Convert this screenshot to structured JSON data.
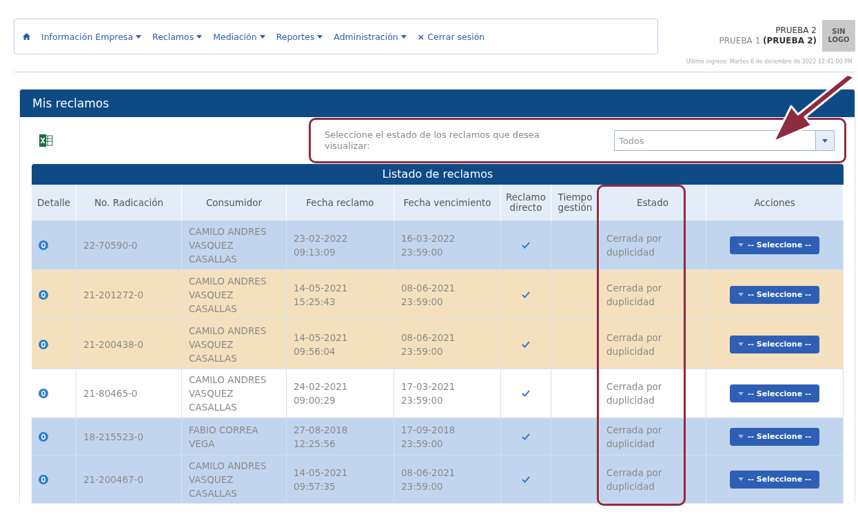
{
  "nav": {
    "items": [
      {
        "label": "Información Empresa",
        "dropdown": true
      },
      {
        "label": "Reclamos",
        "dropdown": true
      },
      {
        "label": "Mediación",
        "dropdown": true
      },
      {
        "label": "Reportes",
        "dropdown": true
      },
      {
        "label": "Administración",
        "dropdown": true
      }
    ],
    "logout_icon": "×",
    "logout": "Cerrar sesión"
  },
  "user": {
    "name": "PRUEBA 2",
    "line_prefix": "PRUEBA 1 ",
    "line_bold": "(PRUEBA 2)",
    "logo": "SIN\nLOGO",
    "last_login": "Ultimo ingreso: Martes 6 de diciembre de 2022 12:41:00 PM"
  },
  "panel": {
    "title": "Mis reclamos",
    "filter": {
      "label": "Seleccione el estado de los reclamos que desea visualizar:",
      "value": "Todos",
      "highlighted": true
    },
    "pointer_arrow": true
  },
  "table": {
    "title": "Listado de reclamos",
    "columns": [
      {
        "label": "Detalle",
        "highlighted": false
      },
      {
        "label": "No. Radicación",
        "highlighted": false
      },
      {
        "label": "Consumidor",
        "highlighted": false
      },
      {
        "label": "Fecha reclamo",
        "highlighted": false
      },
      {
        "label": "Fecha vencimiento",
        "highlighted": false
      },
      {
        "label": "Reclamo directo",
        "highlighted": false
      },
      {
        "label": "Tiempo gestión",
        "highlighted": false
      },
      {
        "label": "Estado",
        "highlighted": true
      },
      {
        "label": "Acciones",
        "highlighted": false
      }
    ],
    "rows": [
      {
        "color": "#c2d5ee",
        "number": "22-70590-0",
        "consumer": "CAMILO ANDRES VASQUEZ CASALLAS",
        "claim_date": [
          "23-02-2022",
          "09:13:09"
        ],
        "due_date": [
          "16-03-2022",
          "23:59:00"
        ],
        "direct": true,
        "status": "Cerrada por duplicidad",
        "action": "-- Seleccione --"
      },
      {
        "color": "#f5e0bd",
        "number": "21-201272-0",
        "consumer": "CAMILO ANDRES VASQUEZ CASALLAS",
        "claim_date": [
          "14-05-2021",
          "15:25:43"
        ],
        "due_date": [
          "08-06-2021",
          "23:59:00"
        ],
        "direct": true,
        "status": "Cerrada por duplicidad",
        "action": "-- Seleccione --"
      },
      {
        "color": "#f5e0bd",
        "number": "21-200438-0",
        "consumer": "CAMILO ANDRES VASQUEZ CASALLAS",
        "claim_date": [
          "14-05-2021",
          "09:56:04"
        ],
        "due_date": [
          "08-06-2021",
          "23:59:00"
        ],
        "direct": true,
        "status": "Cerrada por duplicidad",
        "action": "-- Seleccione --"
      },
      {
        "color": "#ffffff",
        "number": "21-80465-0",
        "consumer": "CAMILO ANDRES VASQUEZ CASALLAS",
        "claim_date": [
          "24-02-2021",
          "09:00:29"
        ],
        "due_date": [
          "17-03-2021",
          "23:59:00"
        ],
        "direct": true,
        "status": "Cerrada por duplicidad",
        "action": "-- Seleccione --"
      },
      {
        "color": "#c2d5ee",
        "number": "18-215523-0",
        "consumer": "FABIO CORREA VEGA",
        "claim_date": [
          "27-08-2018",
          "12:25:56"
        ],
        "due_date": [
          "17-09-2018",
          "23:59:00"
        ],
        "direct": true,
        "status": "Cerrada por duplicidad",
        "action": "-- Seleccione --"
      },
      {
        "color": "#c2d5ee",
        "number": "21-200467-0",
        "consumer": "CAMILO ANDRES VASQUEZ CASALLAS",
        "claim_date": [
          "14-05-2021",
          "09:57:35"
        ],
        "due_date": [
          "08-06-2021",
          "23:59:00"
        ],
        "direct": true,
        "status": "Cerrada por duplicidad",
        "action": "-- Seleccione --"
      }
    ]
  }
}
